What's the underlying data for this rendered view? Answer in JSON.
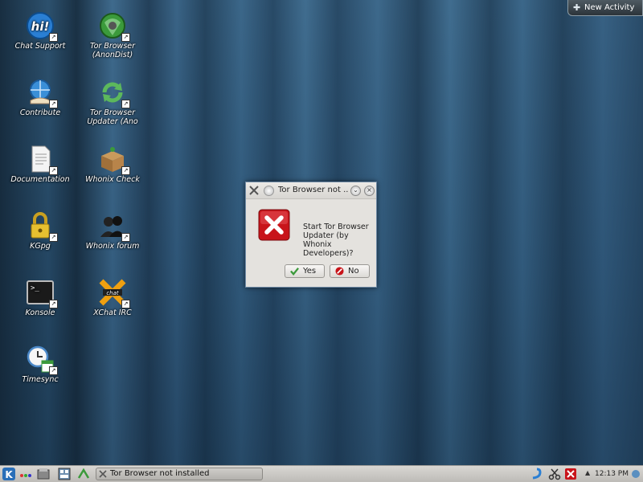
{
  "desktop": {
    "icons": [
      {
        "label": "Chat Support"
      },
      {
        "label": "Tor Browser (AnonDist)"
      },
      {
        "label": "Contribute"
      },
      {
        "label": "Tor Browser Updater (Ano"
      },
      {
        "label": "Documentation"
      },
      {
        "label": "Whonix Check"
      },
      {
        "label": "KGpg"
      },
      {
        "label": "Whonix forum"
      },
      {
        "label": "Konsole"
      },
      {
        "label": "XChat IRC"
      },
      {
        "label": "Timesync"
      }
    ],
    "new_activity_label": "New Activity"
  },
  "dialog": {
    "title": "Tor Browser not ...",
    "message": "Start Tor Browser Updater (by Whonix Developers)?",
    "yes_label": "Yes",
    "no_label": "No"
  },
  "taskbar": {
    "task_label": "Tor Browser not installed",
    "clock": "12:13 PM"
  },
  "colors": {
    "error_red": "#c8141a",
    "dialog_bg": "#e4e2de",
    "taskbar_bg": "#cac8c4"
  }
}
